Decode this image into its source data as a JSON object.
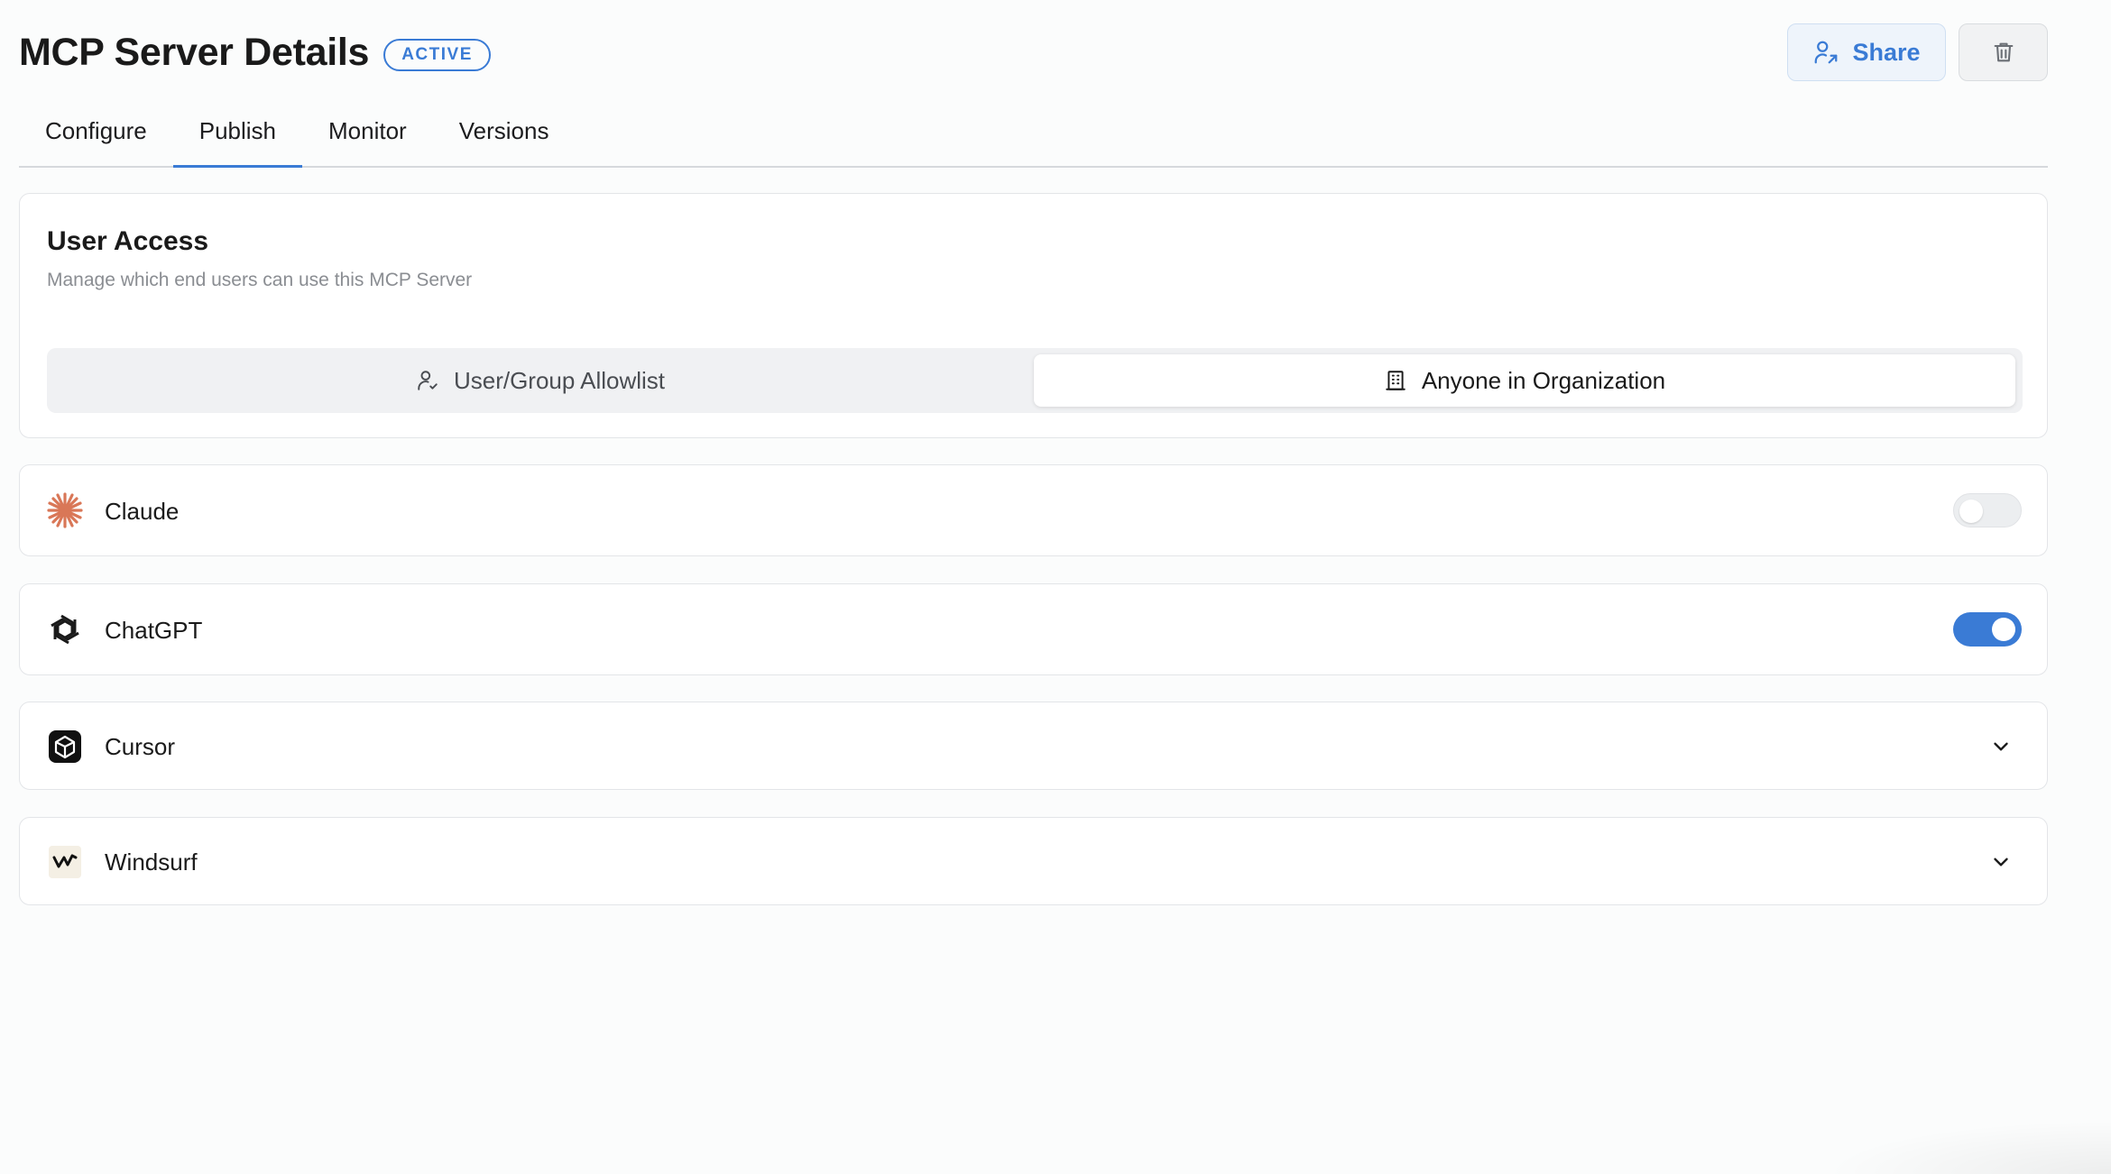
{
  "header": {
    "title": "MCP Server Details",
    "status": "ACTIVE",
    "share_label": "Share",
    "share_icon": "user-share-icon",
    "delete_icon": "trash-icon"
  },
  "tabs": [
    {
      "label": "Configure",
      "active": false
    },
    {
      "label": "Publish",
      "active": true
    },
    {
      "label": "Monitor",
      "active": false
    },
    {
      "label": "Versions",
      "active": false
    }
  ],
  "user_access": {
    "title": "User Access",
    "subtitle": "Manage which end users can use this MCP Server",
    "options": [
      {
        "label": "User/Group Allowlist",
        "icon": "user-check-icon",
        "selected": false
      },
      {
        "label": "Anyone in Organization",
        "icon": "building-icon",
        "selected": true
      }
    ]
  },
  "clients": [
    {
      "name": "Claude",
      "icon": "claude-icon",
      "control": "toggle",
      "enabled": false
    },
    {
      "name": "ChatGPT",
      "icon": "chatgpt-icon",
      "control": "toggle",
      "enabled": true
    },
    {
      "name": "Cursor",
      "icon": "cursor-icon",
      "control": "expand"
    },
    {
      "name": "Windsurf",
      "icon": "windsurf-icon",
      "control": "expand"
    }
  ],
  "colors": {
    "accent": "#3a7bd5",
    "claude_brand": "#d97757",
    "background": "#fbfcfc"
  }
}
